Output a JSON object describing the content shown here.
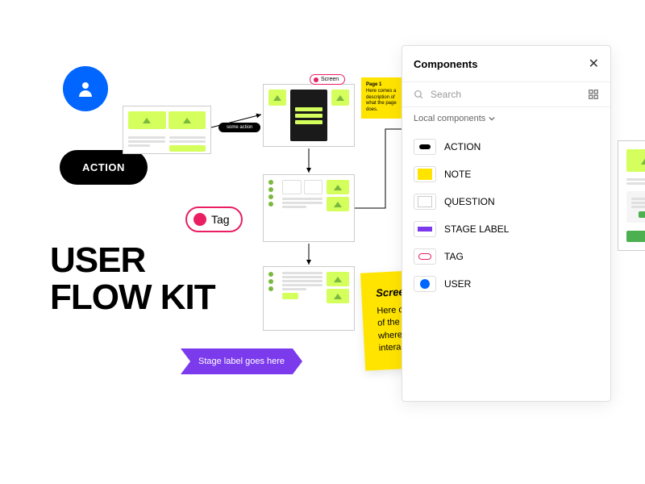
{
  "title_line1": "USER",
  "title_line2": "FLOW KIT",
  "action_label": "ACTION",
  "tag_label": "Tag",
  "stage_label": "Stage label goes here",
  "small_action_label": "some action",
  "small_note_tag": "Screen",
  "small_sticky_title": "Page 1",
  "small_sticky_body": "Here comes a description of what the page does.",
  "big_sticky_title": "Screen Name",
  "big_sticky_body": "Here comes the description of the screen or section where the users need to interact.",
  "panel": {
    "title": "Components",
    "search_placeholder": "Search",
    "section_label": "Local components",
    "items": [
      {
        "label": "ACTION"
      },
      {
        "label": "NOTE"
      },
      {
        "label": "QUESTION"
      },
      {
        "label": "STAGE LABEL"
      },
      {
        "label": "TAG"
      },
      {
        "label": "USER"
      }
    ]
  }
}
